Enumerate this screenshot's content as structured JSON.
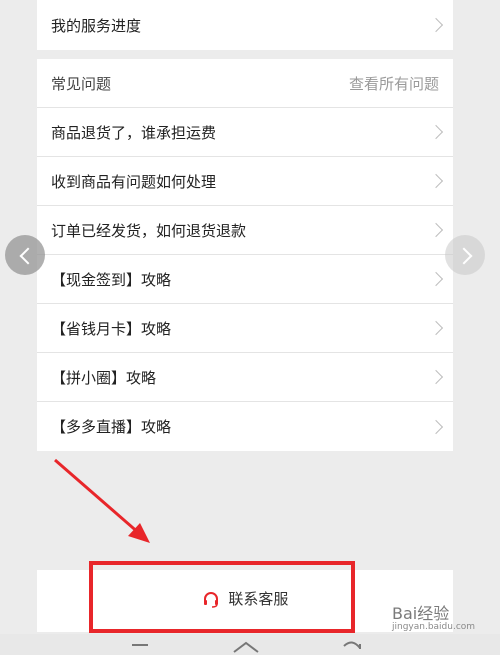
{
  "service_progress": {
    "label": "我的服务进度"
  },
  "faq": {
    "title": "常见问题",
    "view_all": "查看所有问题",
    "items": [
      {
        "label": "商品退货了，谁承担运费"
      },
      {
        "label": "收到商品有问题如何处理"
      },
      {
        "label": "订单已经发货，如何退货退款"
      },
      {
        "label": "【现金签到】攻略"
      },
      {
        "label": "【省钱月卡】攻略"
      },
      {
        "label": "【拼小圈】攻略"
      },
      {
        "label": "【多多直播】攻略"
      }
    ]
  },
  "contact": {
    "label": "联系客服"
  },
  "watermark": {
    "main": "Bai经验",
    "sub": "jingyan.baidu.com"
  },
  "colors": {
    "accent_red": "#e8262a",
    "highlight_red": "#e8262a"
  },
  "icons": [
    "chevron-right-icon",
    "chevron-left-icon",
    "headset-icon",
    "menu-icon",
    "home-icon",
    "back-icon"
  ]
}
